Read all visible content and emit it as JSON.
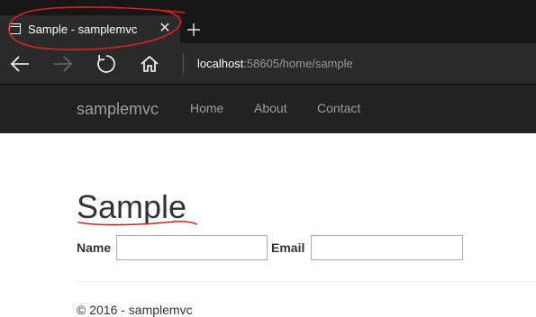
{
  "browser": {
    "tab": {
      "title": "Sample - samplemvc",
      "close_glyph": "✕",
      "icon": "tab-page-icon"
    },
    "new_tab_icon": "plus-icon",
    "nav_icons": [
      "back-arrow-icon",
      "forward-arrow-icon",
      "refresh-icon",
      "home-icon"
    ],
    "address": {
      "host": "localhost",
      "path": ":58605/home/sample"
    }
  },
  "site": {
    "brand": "samplemvc",
    "nav": [
      "Home",
      "About",
      "Contact"
    ]
  },
  "page": {
    "title": "Sample",
    "form": {
      "name_label": "Name",
      "name_value": "",
      "email_label": "Email",
      "email_value": ""
    },
    "footer": "© 2016 - samplemvc"
  },
  "colors": {
    "annotation": "#e02020",
    "chrome_dark": "#171717",
    "navbar": "#222222"
  }
}
